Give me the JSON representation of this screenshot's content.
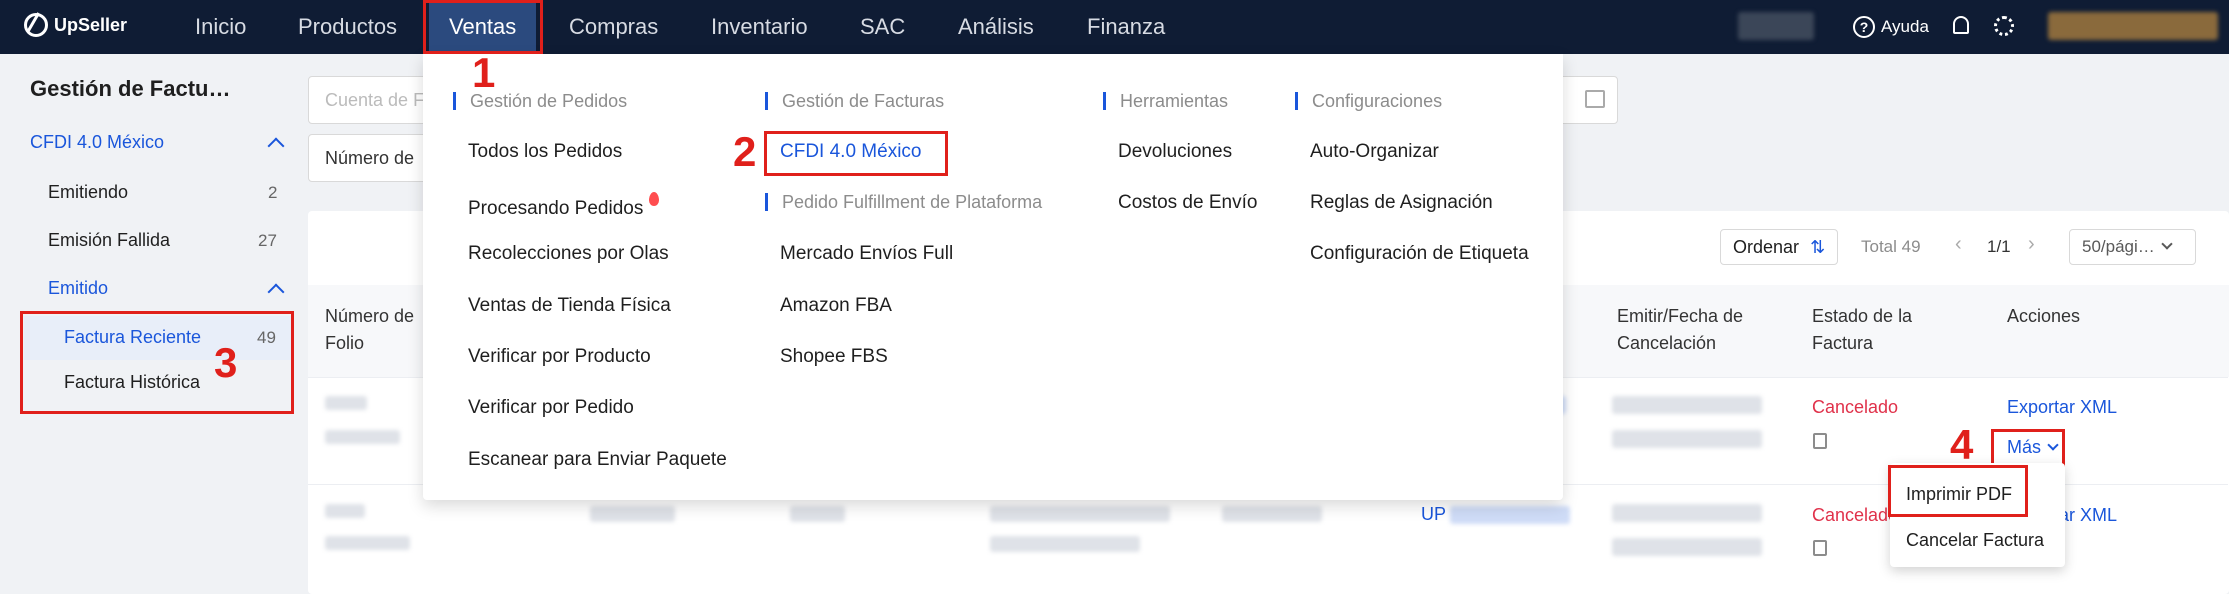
{
  "app": {
    "name": "UpSeller"
  },
  "nav": {
    "items": [
      "Inicio",
      "Productos",
      "Ventas",
      "Compras",
      "Inventario",
      "SAC",
      "Análisis",
      "Finanza"
    ],
    "help_label": "Ayuda"
  },
  "sidebar": {
    "title": "Gestión de Factu…",
    "group": "CFDI 4.0 México",
    "items": [
      {
        "label": "Emitiendo",
        "count": "2"
      },
      {
        "label": "Emisión Fallida",
        "count": "27"
      }
    ],
    "emitido": "Emitido",
    "sub_items": [
      {
        "label": "Factura Reciente",
        "count": "49"
      },
      {
        "label": "Factura Histórica"
      }
    ]
  },
  "filters": {
    "account_placeholder": "Cuenta de F",
    "number_label": "Número de"
  },
  "dropdown": {
    "col1": {
      "header": "Gestión de Pedidos",
      "items": [
        "Todos los Pedidos",
        "Procesando Pedidos",
        "Recolecciones por Olas",
        "Ventas de Tienda Física",
        "Verificar por Producto",
        "Verificar por Pedido",
        "Escanear para Enviar Paquete"
      ]
    },
    "col2": {
      "header": "Gestión de Facturas",
      "link": "CFDI 4.0 México",
      "header2": "Pedido Fulfillment de Plataforma",
      "items": [
        "Mercado Envíos Full",
        "Amazon FBA",
        "Shopee FBS"
      ]
    },
    "col3": {
      "header": "Herramientas",
      "items": [
        "Devoluciones",
        "Costos de Envío"
      ]
    },
    "col4": {
      "header": "Configuraciones",
      "items": [
        "Auto-Organizar",
        "Reglas de Asignación",
        "Configuración de Etiqueta"
      ]
    }
  },
  "toolbar": {
    "sort_label": "Ordenar",
    "total": "Total 49",
    "page": "1/1",
    "page_size": "50/pági…"
  },
  "table": {
    "headers": {
      "folio": "Número de Folio",
      "date": "Emitir/Fecha de Cancelación",
      "status": "Estado de la Factura",
      "actions": "Acciones"
    },
    "rows": [
      {
        "status": "Cancelado",
        "export": "Exportar XML",
        "more": "Más"
      },
      {
        "status": "Cancelado",
        "export": "Exportar XML",
        "order_prefix": "UP"
      }
    ]
  },
  "more_menu": {
    "items": [
      "Imprimir PDF",
      "Cancelar Factura"
    ]
  },
  "annotations": [
    "1",
    "2",
    "3",
    "4"
  ],
  "colors": {
    "topbar": "#0f1c34",
    "accent": "#1a56db",
    "annotation": "#e0201b",
    "status_cancelled": "#e0314a"
  }
}
